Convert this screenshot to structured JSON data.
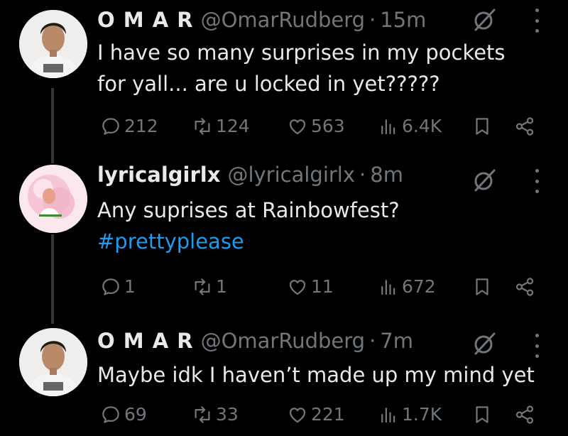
{
  "colors": {
    "background": "#000000",
    "text": "#e7e9ea",
    "muted": "#71767b",
    "link": "#1d9bf0",
    "line": "#333639"
  },
  "tweets": [
    {
      "display_name": "O M A R",
      "handle": "@OmarRudberg",
      "separator": "·",
      "time": "15m",
      "text_lines": [
        "I have so many surprises in my pockets",
        "for yall... are u locked in yet?????"
      ],
      "hashtag": "",
      "replies": "212",
      "reposts": "124",
      "likes": "563",
      "views": "6.4K",
      "icons": [
        "reply-icon",
        "repost-icon",
        "like-icon",
        "views-icon",
        "bookmark-icon",
        "share-icon",
        "grok-icon",
        "more-icon"
      ]
    },
    {
      "display_name": "lyricalgirlx",
      "handle": "@lyricalgirlx",
      "separator": "·",
      "time": "8m",
      "text_lines": [
        "Any suprises at Rainbowfest?"
      ],
      "hashtag": "#prettyplease",
      "replies": "1",
      "reposts": "1",
      "likes": "11",
      "views": "672",
      "icons": [
        "reply-icon",
        "repost-icon",
        "like-icon",
        "views-icon",
        "bookmark-icon",
        "share-icon",
        "grok-icon",
        "more-icon"
      ]
    },
    {
      "display_name": "O M A R",
      "handle": "@OmarRudberg",
      "separator": "·",
      "time": "7m",
      "text_lines": [
        "Maybe idk I haven’t made up my mind yet"
      ],
      "hashtag": "",
      "replies": "69",
      "reposts": "33",
      "likes": "221",
      "views": "1.7K",
      "icons": [
        "reply-icon",
        "repost-icon",
        "like-icon",
        "views-icon",
        "bookmark-icon",
        "share-icon",
        "grok-icon",
        "more-icon"
      ]
    }
  ]
}
